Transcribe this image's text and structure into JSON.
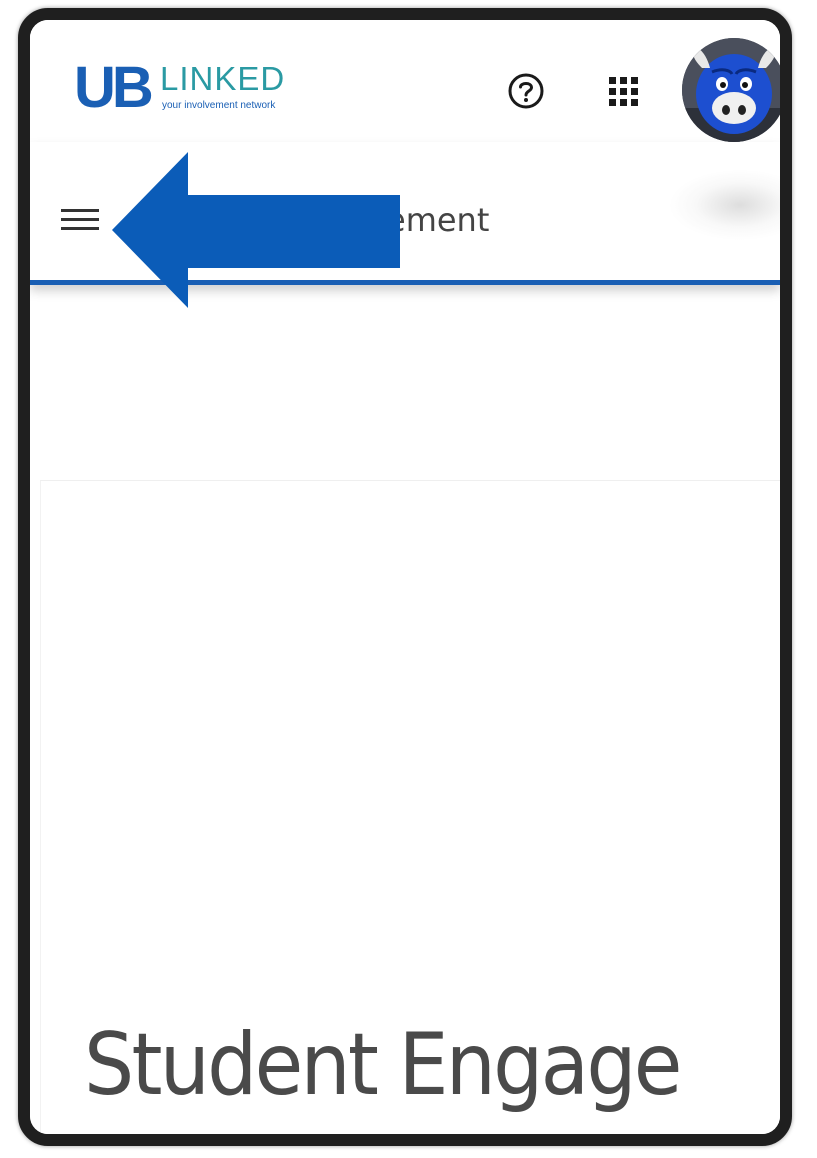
{
  "header": {
    "logo": {
      "ub_text": "UB",
      "linked_text": "LINKED",
      "tagline": "your involvement network"
    },
    "help_icon": "question-circle-icon",
    "apps_icon": "apps-grid-icon",
    "avatar_alt": "user-avatar"
  },
  "sub_bar": {
    "menu_icon": "hamburger-menu-icon",
    "heading_visible": "ement"
  },
  "annotation": {
    "arrow_color": "#0b5cb8",
    "arrow_direction": "left"
  },
  "content": {
    "hero_title": "Student Engage"
  },
  "colors": {
    "brand_blue": "#1a5fb4",
    "brand_teal": "#2a9aa3",
    "divider_blue": "#1a5fb4",
    "frame": "#1f1f1f"
  }
}
